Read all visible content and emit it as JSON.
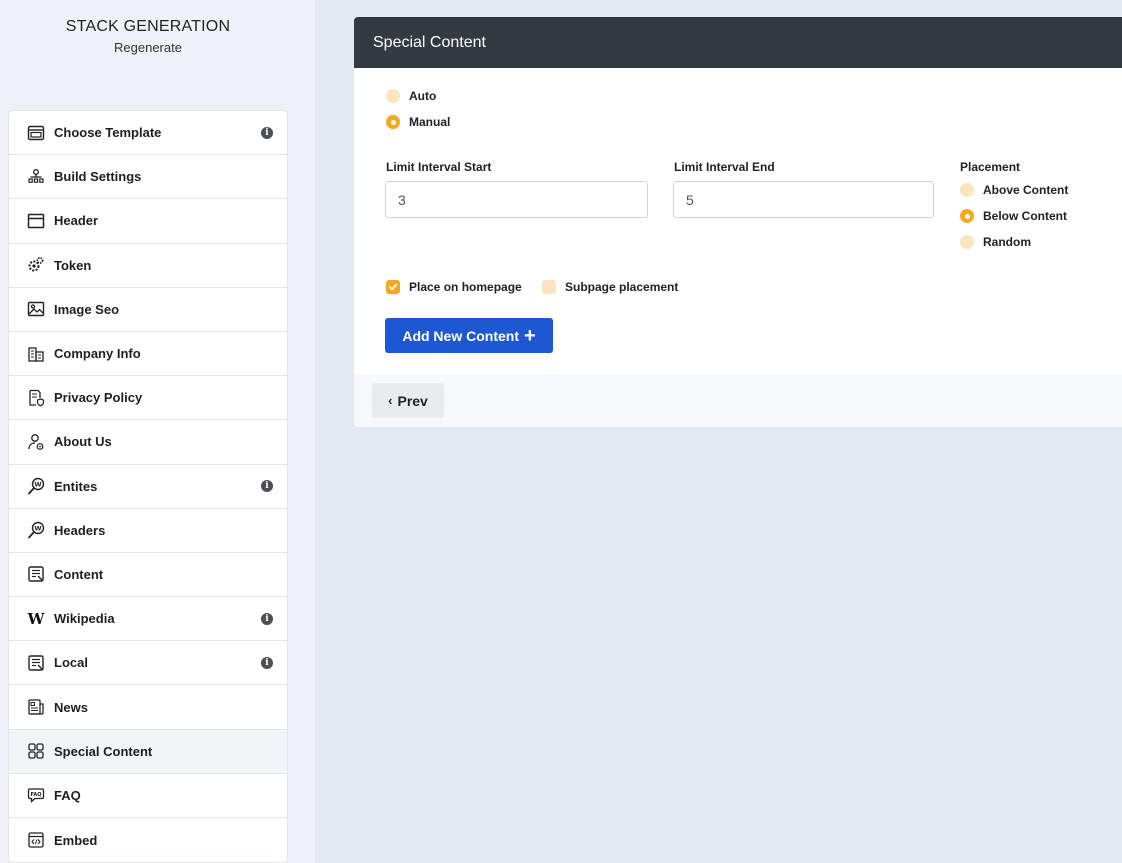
{
  "brand": {
    "title": "STACK GENERATION",
    "subtitle": "Regenerate"
  },
  "sidebar": {
    "items": [
      {
        "label": "Choose Template",
        "icon": "template-icon",
        "info": true
      },
      {
        "label": "Build Settings",
        "icon": "sitemap-icon",
        "info": false
      },
      {
        "label": "Header",
        "icon": "header-layout-icon",
        "info": false
      },
      {
        "label": "Token",
        "icon": "gears-icon",
        "info": false
      },
      {
        "label": "Image Seo",
        "icon": "image-icon",
        "info": false
      },
      {
        "label": "Company Info",
        "icon": "building-icon",
        "info": false
      },
      {
        "label": "Privacy Policy",
        "icon": "policy-icon",
        "info": false
      },
      {
        "label": "About Us",
        "icon": "user-icon",
        "info": false
      },
      {
        "label": "Entites",
        "icon": "wiki-search-icon",
        "info": true
      },
      {
        "label": "Headers",
        "icon": "wiki-search-icon",
        "info": false
      },
      {
        "label": "Content",
        "icon": "document-icon",
        "info": false
      },
      {
        "label": "Wikipedia",
        "icon": "wikipedia-icon",
        "info": true
      },
      {
        "label": "Local",
        "icon": "document-icon",
        "info": true
      },
      {
        "label": "News",
        "icon": "newspaper-icon",
        "info": false
      },
      {
        "label": "Special Content",
        "icon": "grid-icon",
        "info": false,
        "active": true
      },
      {
        "label": "FAQ",
        "icon": "faq-icon",
        "info": false
      },
      {
        "label": "Embed",
        "icon": "embed-icon",
        "info": false
      }
    ]
  },
  "card": {
    "title": "Special Content",
    "mode": {
      "options": [
        "Auto",
        "Manual"
      ],
      "selected": "Manual"
    },
    "limit_start": {
      "label": "Limit Interval Start",
      "value": "3"
    },
    "limit_end": {
      "label": "Limit Interval End",
      "value": "5"
    },
    "placement": {
      "label": "Placement",
      "options": [
        "Above Content",
        "Below Content",
        "Random"
      ],
      "selected": "Below Content"
    },
    "place_on_homepage": {
      "label": "Place on homepage",
      "checked": true
    },
    "subpage_placement": {
      "label": "Subpage placement",
      "checked": false
    },
    "add_button": "Add New Content",
    "prev_button": "Prev"
  },
  "colors": {
    "accent": "#f4a823",
    "accent_light": "#fbe5bf",
    "primary": "#1d57d1",
    "header_bg": "#343a40"
  }
}
